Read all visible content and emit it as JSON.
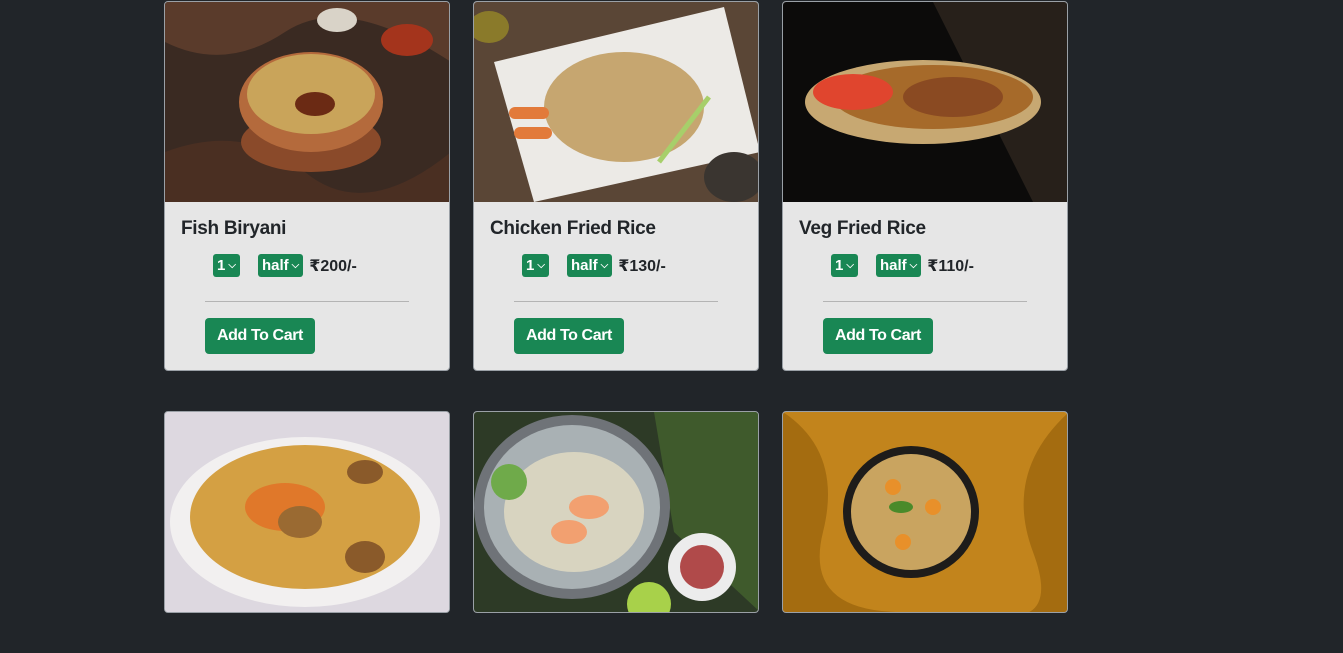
{
  "products": [
    {
      "name": "Fish Biryani",
      "qty": "1",
      "size": "half",
      "price": "₹200/-",
      "button": "Add To Cart"
    },
    {
      "name": "Chicken Fried Rice",
      "qty": "1",
      "size": "half",
      "price": "₹130/-",
      "button": "Add To Cart"
    },
    {
      "name": "Veg Fried Rice",
      "qty": "1",
      "size": "half",
      "price": "₹110/-",
      "button": "Add To Cart"
    }
  ],
  "colors": {
    "background": "#212529",
    "card": "#e6e6e6",
    "accent": "#198754"
  },
  "icons": {
    "dropdown": "chevron-down-icon"
  }
}
